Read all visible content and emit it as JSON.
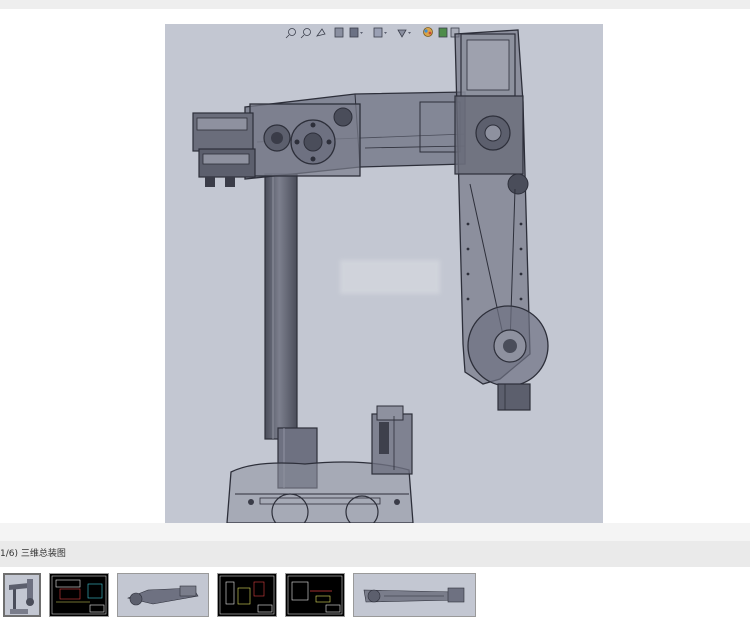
{
  "caption": {
    "text": "1/6) 三维总装图"
  },
  "toolbar": {
    "icons": [
      "zoom-fit-icon",
      "zoom-area-icon",
      "previous-view-icon",
      "section-view-icon",
      "view-orientation-icon",
      "display-style-icon",
      "hide-show-icon",
      "appearance-icon",
      "scene-icon",
      "render-icon"
    ]
  },
  "thumbnails": [
    {
      "name": "thumbnail-3d-assembly",
      "kind": "3d-upright",
      "active": true
    },
    {
      "name": "thumbnail-drawing-1",
      "kind": "drawing",
      "active": false
    },
    {
      "name": "thumbnail-3d-arm-side",
      "kind": "3d-horizontal",
      "active": false
    },
    {
      "name": "thumbnail-drawing-2",
      "kind": "drawing",
      "active": false
    },
    {
      "name": "thumbnail-drawing-3",
      "kind": "drawing",
      "active": false
    },
    {
      "name": "thumbnail-3d-arm-top",
      "kind": "3d-horizontal",
      "active": false
    }
  ],
  "colors": {
    "viewport_background": "#c3c7d2",
    "part_fill": "#6e7181",
    "part_edge": "#2d2f3a",
    "drawing_background": "#000000"
  }
}
